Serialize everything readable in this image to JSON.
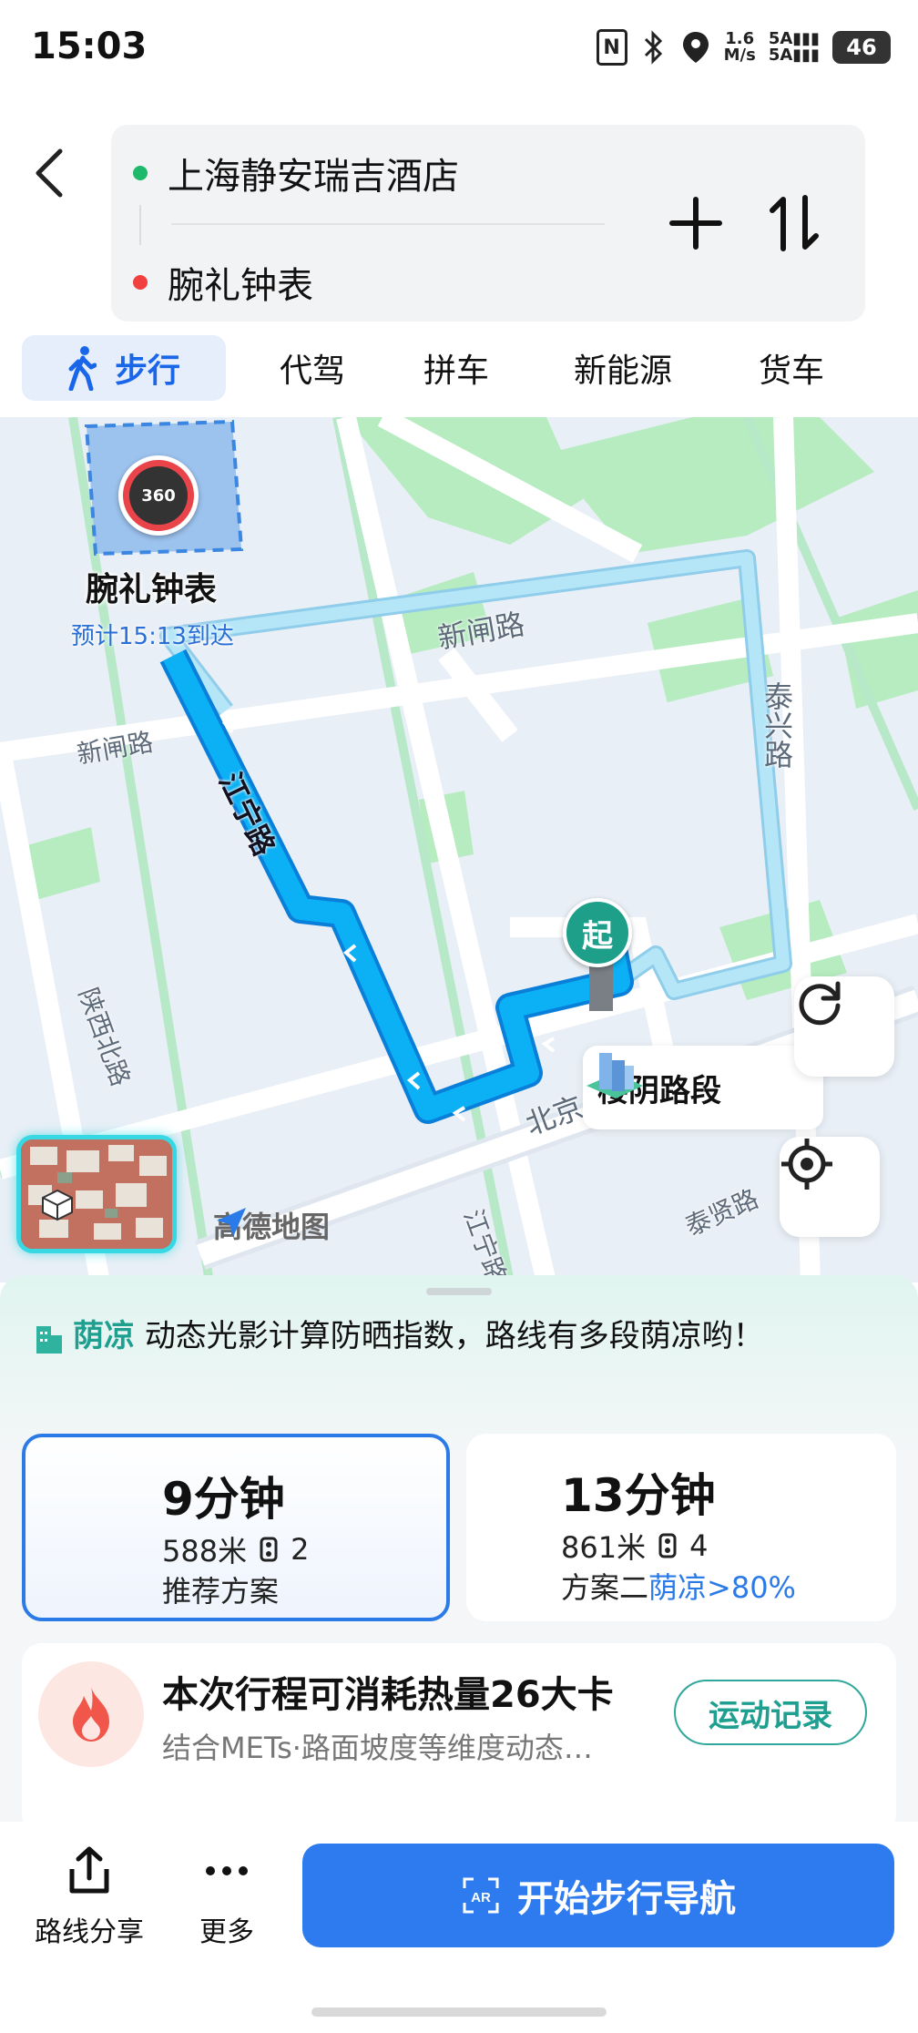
{
  "status_bar": {
    "time": "15:03",
    "speed_value": "1.6",
    "speed_unit": "M/s",
    "network_1": "5A",
    "network_2": "5A",
    "battery": "46"
  },
  "route": {
    "origin": "上海静安瑞吉酒店",
    "destination": "腕礼钟表"
  },
  "mode_tabs": [
    {
      "label": "步行",
      "active": true
    },
    {
      "label": "代驾",
      "active": false
    },
    {
      "label": "拼车",
      "active": false
    },
    {
      "label": "新能源",
      "active": false
    },
    {
      "label": "货车",
      "active": false
    }
  ],
  "map": {
    "destination_label": "腕礼钟表",
    "eta": "预计15:13到达",
    "start_marker": "起",
    "pano_badge": "360",
    "shade_segment_label": "楼阴路段",
    "logo_text": "高德地图",
    "roads": {
      "xinzha_upper": "新闸路",
      "xinzha_left": "新闸路",
      "jiangning": "江宁路",
      "jiangning_lower": "江宁路",
      "taixing": "泰兴路",
      "shaanxi_north": "陕西北路",
      "beijing": "北京",
      "taixian": "泰贤路"
    }
  },
  "sheet": {
    "shade_title": "荫凉",
    "shade_text": "动态光影计算防晒指数，路线有多段荫凉哟！",
    "plans": [
      {
        "time": "9分钟",
        "distance": "588米",
        "lights": "2",
        "tag": "推荐方案",
        "selected": true
      },
      {
        "time": "13分钟",
        "distance": "861米",
        "lights": "4",
        "tag": "方案二",
        "tag_extra": "荫凉>80%",
        "selected": false
      }
    ],
    "calorie": {
      "title": "本次行程可消耗热量26大卡",
      "subtitle": "结合METs·路面坡度等维度动态…",
      "button": "运动记录"
    }
  },
  "bottom_bar": {
    "share_label": "路线分享",
    "more_label": "更多",
    "nav_icon_text": "AR",
    "nav_label": "开始步行导航"
  },
  "colors": {
    "accent_blue": "#2e7bf0",
    "route_blue": "#0aa6ef",
    "alt_route": "#9fdcf2",
    "shade_green": "#1e9f8f"
  }
}
